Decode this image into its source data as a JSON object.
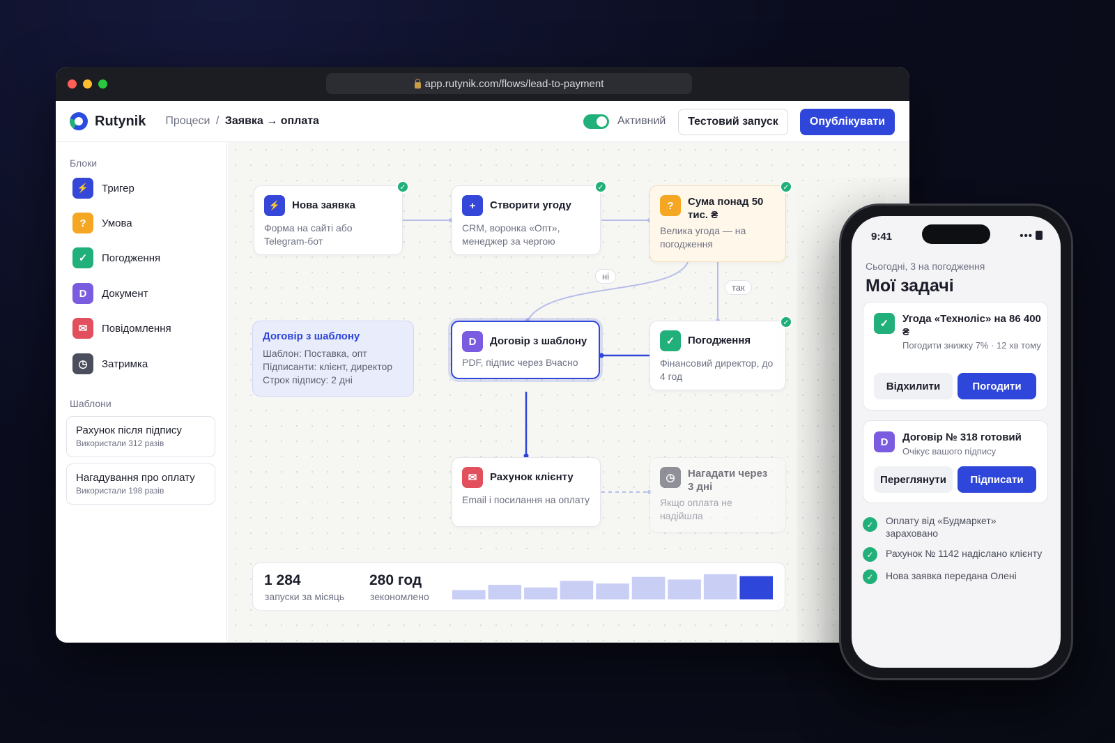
{
  "browser": {
    "url": "app.rutynik.com/flows/lead-to-payment"
  },
  "header": {
    "logo_text": "Rutynik",
    "breadcrumb_parent": "Процеси",
    "breadcrumb_sep": "/",
    "breadcrumb_current": "Заявка → оплата",
    "toggle_label": "Активний",
    "toggle_on": true,
    "test_button": "Тестовий запуск",
    "publish_button": "Опублікувати"
  },
  "sidebar": {
    "blocks_title": "Блоки",
    "blocks": [
      {
        "label": "Тригер",
        "icon": "lightning-icon",
        "glyph": "⚡"
      },
      {
        "label": "Умова",
        "icon": "question-icon",
        "glyph": "?"
      },
      {
        "label": "Погодження",
        "icon": "check-icon",
        "glyph": "✓"
      },
      {
        "label": "Документ",
        "icon": "document-icon",
        "glyph": "D"
      },
      {
        "label": "Повідомлення",
        "icon": "mail-icon",
        "glyph": "✉"
      },
      {
        "label": "Затримка",
        "icon": "timer-icon",
        "glyph": "◷"
      }
    ],
    "templates_title": "Шаблони",
    "templates": [
      {
        "name": "Рахунок після підпису",
        "usage": "Використали 312 разів"
      },
      {
        "name": "Нагадування про оплату",
        "usage": "Використали 198 разів"
      }
    ]
  },
  "flow": {
    "nodes": {
      "new_lead": {
        "title": "Нова заявка",
        "desc": "Форма на сайті або Telegram-бот",
        "icon": "lightning-icon",
        "glyph": "⚡"
      },
      "create_deal": {
        "title": "Створити угоду",
        "desc": "CRM, воронка «Опт», менеджер за чергою",
        "icon": "plus-icon",
        "glyph": "+"
      },
      "amount_condition": {
        "title": "Сума понад 50 тис. ₴",
        "desc": "Велика угода — на погодження",
        "icon": "question-icon",
        "glyph": "?"
      },
      "contract": {
        "title": "Договір з шаблону",
        "desc": "PDF, підпис через Вчасно",
        "icon": "document-icon",
        "glyph": "D"
      },
      "approval": {
        "title": "Погодження",
        "desc": "Фінансовий директор, до 4 год",
        "icon": "check-icon",
        "glyph": "✓"
      },
      "invoice": {
        "title": "Рахунок клієнту",
        "desc": "Email і посилання на оплату",
        "icon": "mail-icon",
        "glyph": "✉"
      },
      "reminder": {
        "title": "Нагадати через 3 дні",
        "desc": "Якщо оплата не надійшла",
        "icon": "timer-icon",
        "glyph": "◷"
      }
    },
    "edge_labels": {
      "no": "ні",
      "yes": "так"
    },
    "check_glyph": "✓",
    "detail": {
      "title": "Договір з шаблону",
      "lines": [
        "Шаблон: Поставка, опт",
        "Підписанти: клієнт, директор",
        "Строк підпису: 2 дні"
      ]
    }
  },
  "stats": {
    "runs_value": "1 284",
    "runs_label": "запуски за місяць",
    "saved_value": "280 год",
    "saved_label": "зекономлено",
    "bars": [
      0.35,
      0.55,
      0.45,
      0.7,
      0.6,
      0.85,
      0.75,
      0.95,
      0.88
    ],
    "bar_color": "#c9cef5",
    "bar_active_color": "#2e46d9"
  },
  "phone": {
    "time": "9:41",
    "signal": "•••",
    "subtitle": "Сьогодні, 3 на погодження",
    "title": "Мої задачі",
    "tasks": [
      {
        "title": "Угода «Техноліс» на 86 400 ₴",
        "sub": "Погодити знижку 7% · 12 хв тому",
        "icon": "check-icon",
        "glyph": "✓",
        "secondary": "Відхилити",
        "primary": "Погодити"
      },
      {
        "title": "Договір № 318 готовий",
        "sub": "Очікує вашого підпису",
        "icon": "document-icon",
        "glyph": "D",
        "secondary": "Переглянути",
        "primary": "Підписати"
      }
    ],
    "done": [
      "Оплату від «Будмаркет» зараховано",
      "Рахунок № 1142 надіслано клієнту",
      "Нова заявка передана Олені"
    ]
  },
  "colors": {
    "accent": "#2e46d9",
    "success": "#22b07a",
    "warning": "#f5a623",
    "danger": "#e2505e",
    "doc": "#7a5ce0"
  }
}
